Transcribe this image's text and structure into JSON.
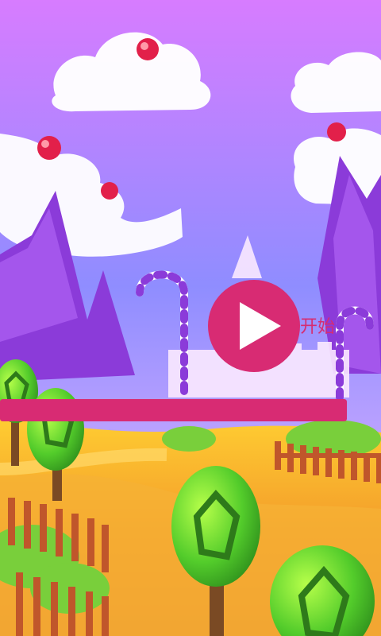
{
  "start_label": "开始",
  "progress": {
    "fraction": 1.0
  },
  "icons": {
    "play": "play-icon"
  },
  "colors": {
    "accent": "#d82b73",
    "sky_top": "#b45cff",
    "sky_bottom": "#7c86ff",
    "ground": "#f3a23a",
    "play_icon": "#ffffff"
  }
}
